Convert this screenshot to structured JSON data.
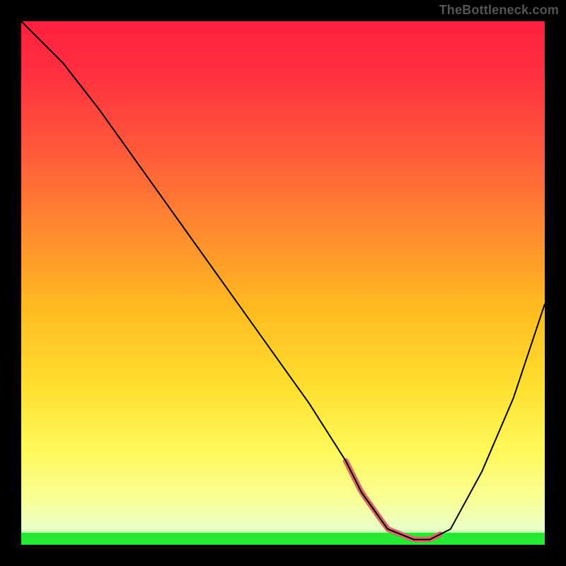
{
  "watermark": "TheBottleneck.com",
  "gradient": {
    "stops": [
      {
        "offset": 0.0,
        "color": "#ff1f3f"
      },
      {
        "offset": 0.1,
        "color": "#ff3040"
      },
      {
        "offset": 0.25,
        "color": "#ff5a3a"
      },
      {
        "offset": 0.4,
        "color": "#ff8a30"
      },
      {
        "offset": 0.55,
        "color": "#ffbb20"
      },
      {
        "offset": 0.7,
        "color": "#ffe030"
      },
      {
        "offset": 0.82,
        "color": "#fff85a"
      },
      {
        "offset": 0.92,
        "color": "#f8ff9a"
      },
      {
        "offset": 0.97,
        "color": "#eaffc8"
      },
      {
        "offset": 1.0,
        "color": "#27e833"
      }
    ]
  },
  "chart_data": {
    "type": "line",
    "title": "",
    "xlabel": "",
    "ylabel": "",
    "xlim": [
      0,
      100
    ],
    "ylim": [
      0,
      100
    ],
    "series": [
      {
        "name": "curve",
        "x": [
          0,
          3,
          8,
          15,
          25,
          35,
          45,
          55,
          62,
          65,
          70,
          75,
          78,
          82,
          88,
          94,
          100
        ],
        "values": [
          100,
          97,
          92,
          83,
          69,
          55,
          41,
          27,
          16,
          10,
          3,
          1,
          1,
          3,
          14,
          28,
          46
        ]
      }
    ],
    "valley_highlight": {
      "x_start": 62,
      "x_end": 80
    },
    "green_band_height_pct": 2.3
  }
}
